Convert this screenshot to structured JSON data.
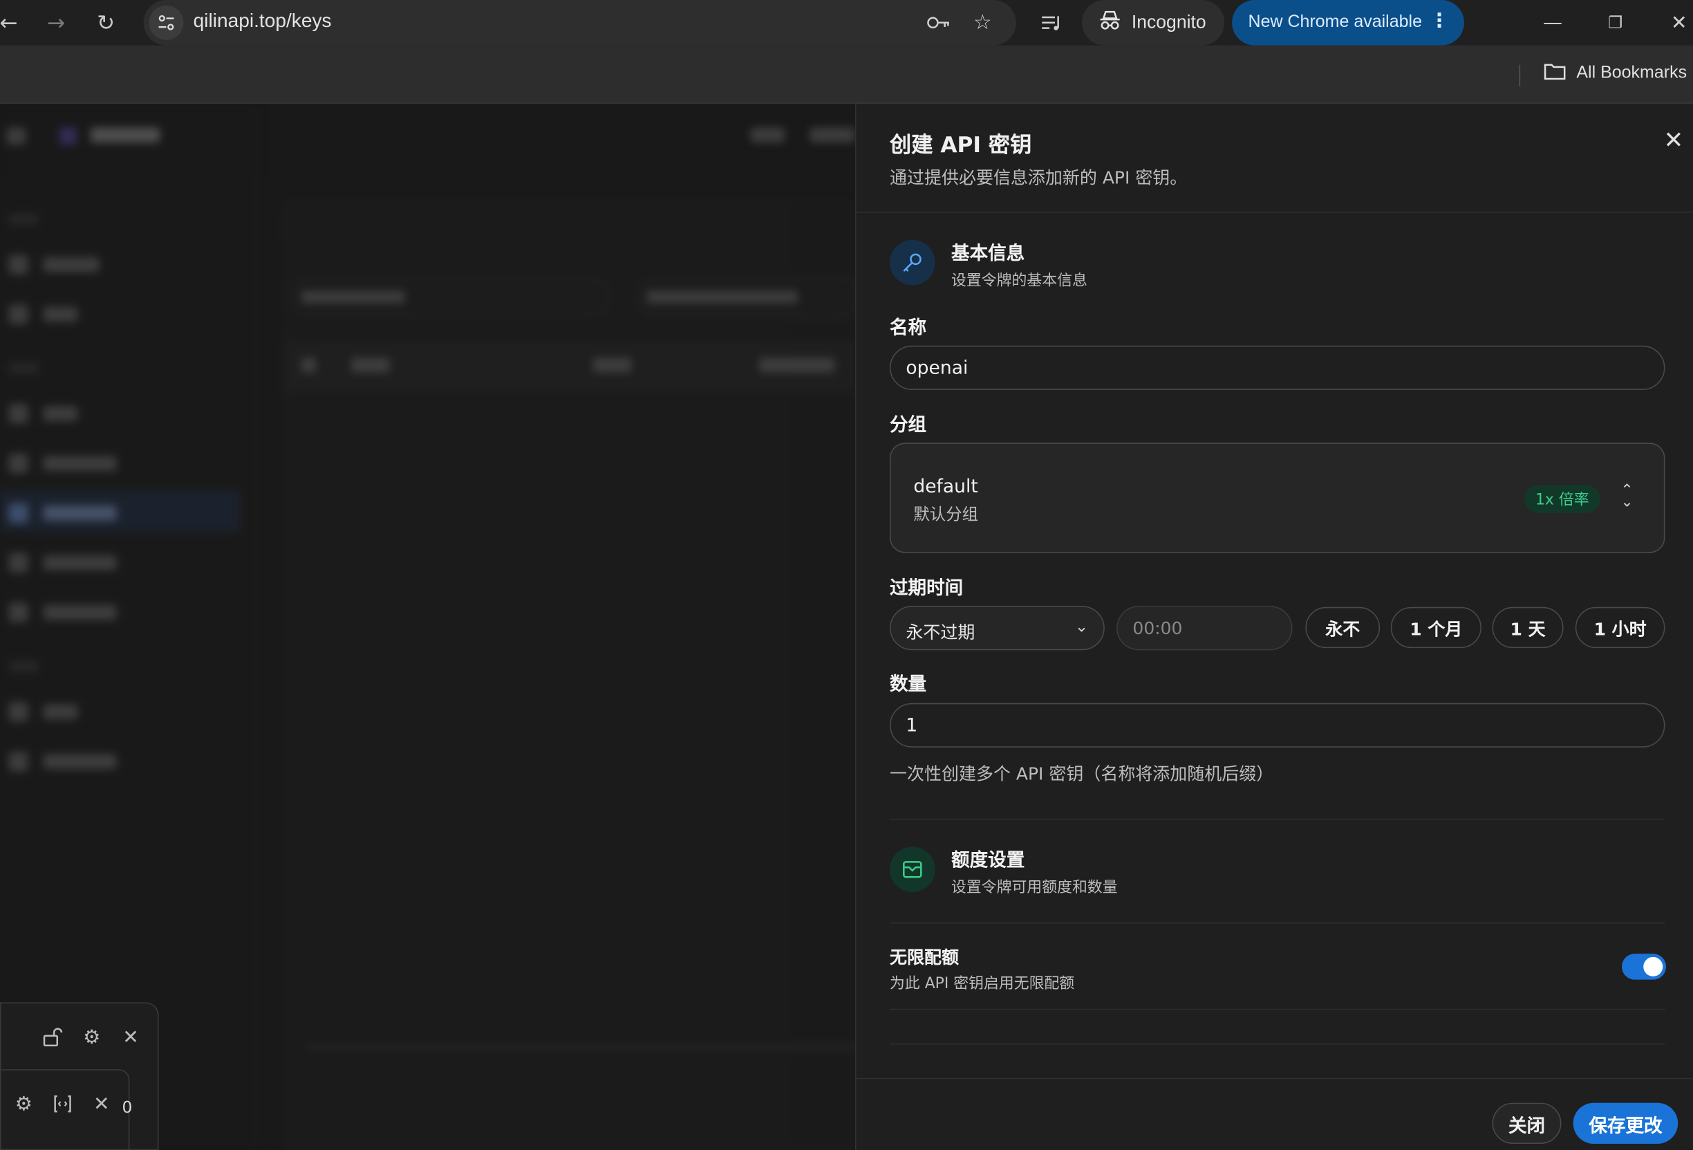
{
  "browser": {
    "url": "qilinapi.top/keys",
    "incognito_label": "Incognito",
    "update_label": "New Chrome available",
    "bookmarks_label": "All Bookmarks"
  },
  "panel": {
    "title": "创建 API 密钥",
    "subtitle": "通过提供必要信息添加新的 API 密钥。",
    "basic_section": {
      "title": "基本信息",
      "description": "设置令牌的基本信息"
    },
    "name_field": {
      "label": "名称",
      "value": "openai"
    },
    "group_field": {
      "label": "分组",
      "selected_name": "default",
      "selected_desc": "默认分组",
      "ratio_badge": "1x 倍率"
    },
    "expire_field": {
      "label": "过期时间",
      "selected": "永不过期",
      "time_placeholder": "00:00",
      "quick_options": [
        "永不",
        "1 个月",
        "1 天",
        "1 小时"
      ]
    },
    "count_field": {
      "label": "数量",
      "value": "1",
      "hint": "一次性创建多个 API 密钥（名称将添加随机后缀）"
    },
    "quota_section": {
      "title": "额度设置",
      "description": "设置令牌可用额度和数量"
    },
    "unlimited": {
      "title": "无限配额",
      "description": "为此 API 密钥启用无限配额",
      "enabled": true
    },
    "buttons": {
      "close": "关闭",
      "save": "保存更改"
    }
  },
  "floating_toolbar": {
    "count": "0"
  },
  "colors": {
    "accent_blue": "#1a73d6",
    "badge_green": "#3ccf8e",
    "basic_icon_bg": "#16304a",
    "quota_icon_bg": "#12372a"
  }
}
